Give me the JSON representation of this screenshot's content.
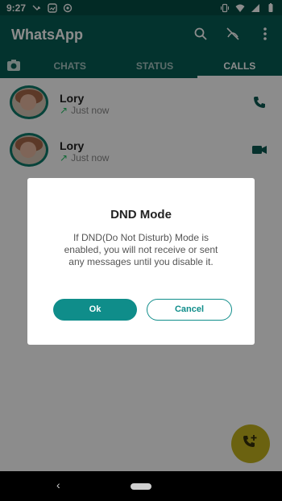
{
  "status_bar": {
    "time": "9:27"
  },
  "app": {
    "title": "WhatsApp"
  },
  "tabs": {
    "chats": "CHATS",
    "status": "STATUS",
    "calls": "CALLS"
  },
  "calls": [
    {
      "name": "Lory",
      "time": "Just now",
      "type": "phone-icon"
    },
    {
      "name": "Lory",
      "time": "Just now",
      "type": "video-icon"
    }
  ],
  "dialog": {
    "title": "DND Mode",
    "message": "If DND(Do Not Disturb) Mode is enabled, you will not receive or sent any messages until you disable it.",
    "ok_label": "Ok",
    "cancel_label": "Cancel"
  },
  "colors": {
    "primary": "#075e54",
    "accent": "#0f8d8a",
    "fab": "#fbe320"
  }
}
